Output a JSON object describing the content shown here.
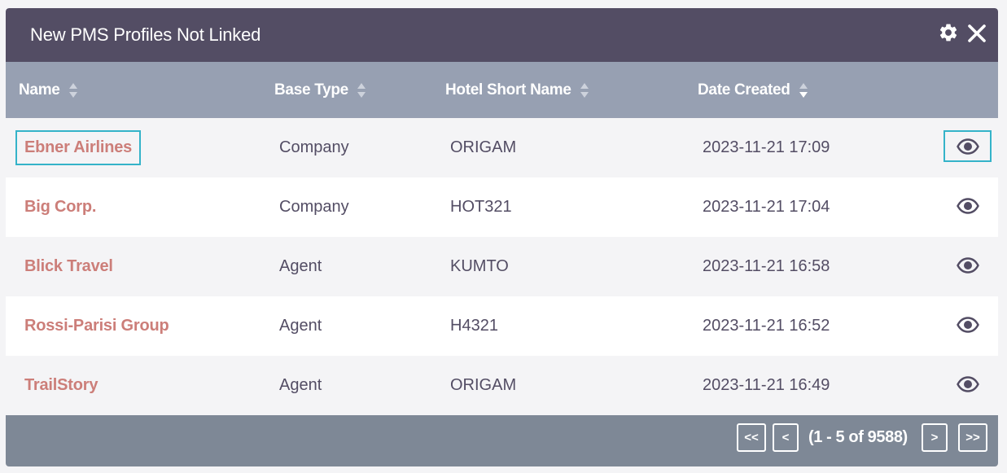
{
  "dashlet": {
    "title": "New PMS Profiles Not Linked"
  },
  "colors": {
    "header_bg": "#534d64",
    "table_header_bg": "#97a0b2",
    "footer_bg": "#7e8896",
    "link": "#cc7e79",
    "focus_ring": "#34b3c9",
    "text": "#534d64"
  },
  "icons": {
    "settings": "gear-icon",
    "close": "close-icon",
    "view": "eye-icon",
    "sort": "sort-arrows-icon"
  },
  "table": {
    "columns": [
      "Name",
      "Base Type",
      "Hotel Short Name",
      "Date Created"
    ],
    "rows": [
      {
        "name": "Ebner Airlines",
        "base_type": "Company",
        "hotel": "ORIGAM",
        "date": "2023-11-21 17:09"
      },
      {
        "name": "Big Corp.",
        "base_type": "Company",
        "hotel": "HOT321",
        "date": "2023-11-21 17:04"
      },
      {
        "name": "Blick Travel",
        "base_type": "Agent",
        "hotel": "KUMTO",
        "date": "2023-11-21 16:58"
      },
      {
        "name": "Rossi-Parisi Group",
        "base_type": "Agent",
        "hotel": "H4321",
        "date": "2023-11-21 16:52"
      },
      {
        "name": "TrailStory",
        "base_type": "Agent",
        "hotel": "ORIGAM",
        "date": "2023-11-21 16:49"
      }
    ]
  },
  "pagination": {
    "first_label": "<<",
    "prev_label": "<",
    "range_text": "(1 - 5 of 9588)",
    "next_label": ">",
    "last_label": ">>"
  }
}
